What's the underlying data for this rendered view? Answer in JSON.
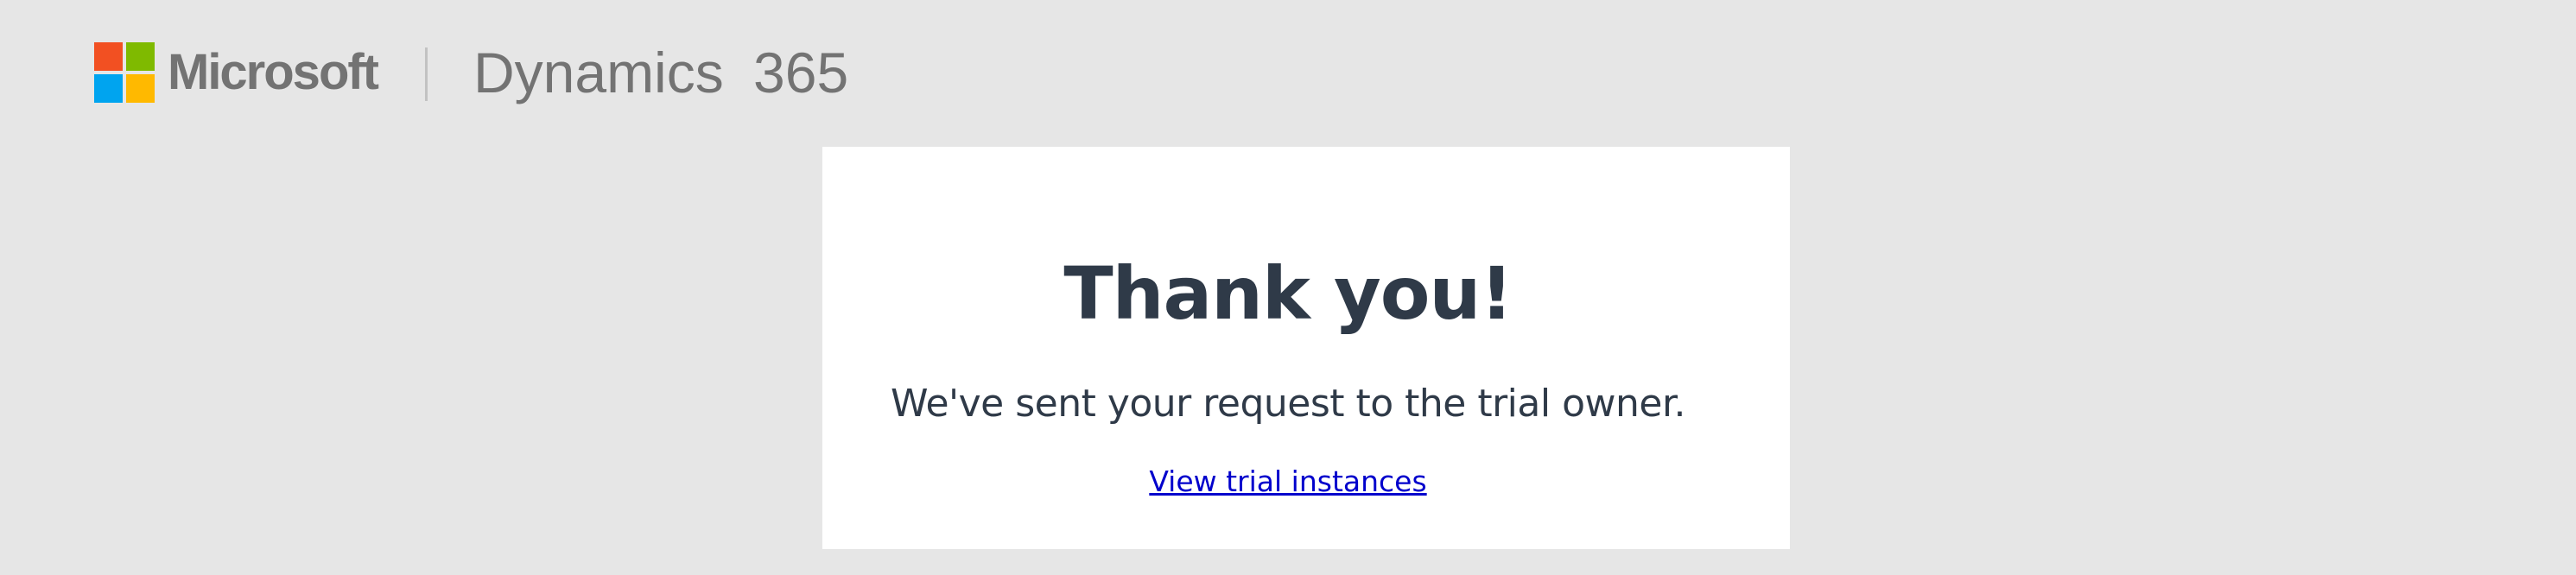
{
  "header": {
    "brand": "Microsoft",
    "product": "Dynamics 365",
    "logo_colors": [
      "#f25022",
      "#7fba00",
      "#00a4ef",
      "#ffb900"
    ]
  },
  "card": {
    "title": "Thank you!",
    "message": "We've sent your request to the trial owner.",
    "link_label": "View trial instances"
  },
  "colors": {
    "background": "#e6e6e6",
    "card": "#ffffff",
    "text": "#2f3a48",
    "link": "#0000cc"
  }
}
